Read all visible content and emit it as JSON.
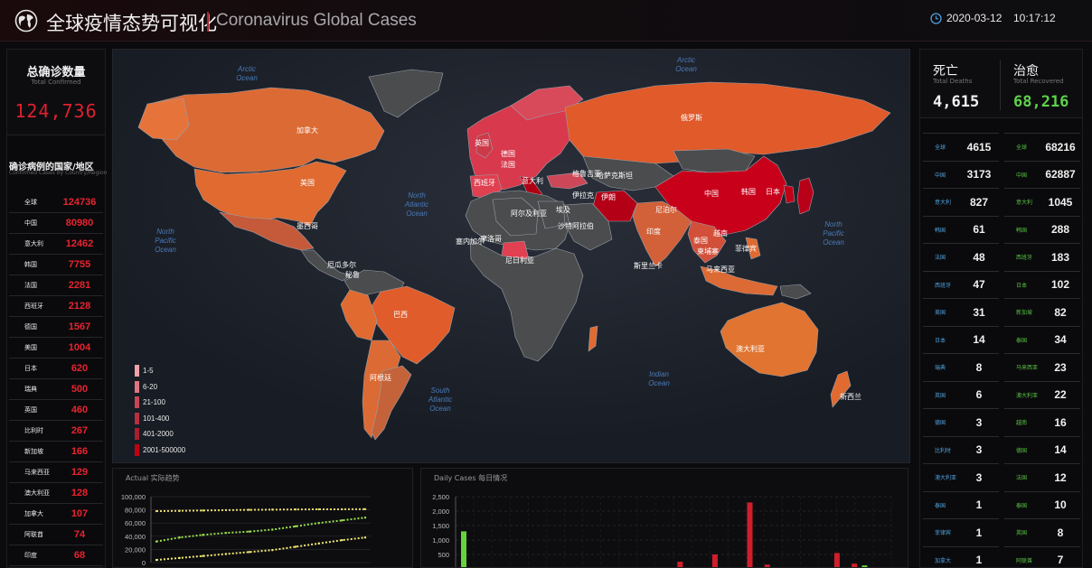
{
  "header": {
    "title_cn": "全球疫情态势可视化",
    "title_en": "Coronavirus Global Cases",
    "date": "2020-03-12",
    "time": "10:17:12",
    "icons": [
      "globe-icon",
      "clock-icon"
    ],
    "accent": "#b0232f"
  },
  "total_confirmed": {
    "label_cn": "总确诊数量",
    "label_en": "Total Confirmed",
    "value": "124,736"
  },
  "country_list": {
    "title_cn": "确诊病例的国家/地区",
    "title_en": "Confirmed Cases by Country/Region",
    "rows": [
      {
        "name": "全球",
        "value": "124736"
      },
      {
        "name": "中国",
        "value": "80980"
      },
      {
        "name": "意大利",
        "value": "12462"
      },
      {
        "name": "韩国",
        "value": "7755"
      },
      {
        "name": "法国",
        "value": "2281"
      },
      {
        "name": "西班牙",
        "value": "2128"
      },
      {
        "name": "德国",
        "value": "1567"
      },
      {
        "name": "美国",
        "value": "1004"
      },
      {
        "name": "日本",
        "value": "620"
      },
      {
        "name": "瑞典",
        "value": "500"
      },
      {
        "name": "英国",
        "value": "460"
      },
      {
        "name": "比利时",
        "value": "267"
      },
      {
        "name": "新加坡",
        "value": "166"
      },
      {
        "name": "马来西亚",
        "value": "129"
      },
      {
        "name": "澳大利亚",
        "value": "128"
      },
      {
        "name": "加拿大",
        "value": "107"
      },
      {
        "name": "阿联酋",
        "value": "74"
      },
      {
        "name": "印度",
        "value": "68"
      }
    ]
  },
  "map": {
    "oceans": [
      {
        "name": "Arctic Ocean",
        "l1": "Arctic",
        "l2": "Ocean"
      },
      {
        "name": "Arctic Ocean 2",
        "l1": "Arctic",
        "l2": "Ocean"
      },
      {
        "name": "North Atlantic Ocean",
        "l1": "North",
        "l2": "Atlantic",
        "l3": "Ocean"
      },
      {
        "name": "North Pacific Ocean W",
        "l1": "North",
        "l2": "Pacific",
        "l3": "Ocean"
      },
      {
        "name": "North Pacific Ocean E",
        "l1": "North",
        "l2": "Pacific",
        "l3": "Ocean"
      },
      {
        "name": "South Atlantic Ocean",
        "l1": "South",
        "l2": "Atlantic",
        "l3": "Ocean"
      },
      {
        "name": "Indian Ocean",
        "l1": "Indian",
        "l2": "Ocean"
      }
    ],
    "countries": [
      "加拿大",
      "美国",
      "墨西哥",
      "巴西",
      "秘鲁",
      "阿根廷",
      "厄瓜多尔",
      "俄罗斯",
      "中国",
      "韩国",
      "日本",
      "伊朗",
      "伊拉克",
      "印度",
      "澳大利亚",
      "新西兰",
      "尼日利亚",
      "阿尔及利亚",
      "埃及",
      "摩洛哥",
      "格鲁吉亚",
      "斯里兰卡",
      "英国",
      "德国",
      "法国",
      "西班牙",
      "意大利",
      "泰国",
      "菲律宾",
      "越南",
      "尼泊尔",
      "柬埔寨",
      "马来西亚",
      "塞内加尔",
      "沙特阿拉伯",
      "哈萨克斯坦"
    ],
    "legend": [
      {
        "label": "1-5",
        "color": "#f0a2a8"
      },
      {
        "label": "6-20",
        "color": "#e07480"
      },
      {
        "label": "21-100",
        "color": "#c84656"
      },
      {
        "label": "101-400",
        "color": "#b83040"
      },
      {
        "label": "401-2000",
        "color": "#a8202e"
      },
      {
        "label": "2001-500000",
        "color": "#c00014"
      }
    ]
  },
  "deaths": {
    "label_cn": "死亡",
    "label_en": "Total Deaths",
    "value": "4,615",
    "rows": [
      {
        "name": "全球",
        "value": "4615"
      },
      {
        "name": "中国",
        "value": "3173"
      },
      {
        "name": "意大利",
        "value": "827"
      },
      {
        "name": "韩国",
        "value": "61"
      },
      {
        "name": "法国",
        "value": "48"
      },
      {
        "name": "西班牙",
        "value": "47"
      },
      {
        "name": "美国",
        "value": "31"
      },
      {
        "name": "日本",
        "value": "14"
      },
      {
        "name": "瑞典",
        "value": "8"
      },
      {
        "name": "英国",
        "value": "6"
      },
      {
        "name": "德国",
        "value": "3"
      },
      {
        "name": "比利时",
        "value": "3"
      },
      {
        "name": "澳大利亚",
        "value": "3"
      },
      {
        "name": "泰国",
        "value": "1"
      },
      {
        "name": "菲律宾",
        "value": "1"
      },
      {
        "name": "加拿大",
        "value": "1"
      }
    ]
  },
  "recovered": {
    "label_cn": "治愈",
    "label_en": "Total Recovered",
    "value": "68,216",
    "rows": [
      {
        "name": "全球",
        "value": "68216"
      },
      {
        "name": "中国",
        "value": "62887"
      },
      {
        "name": "意大利",
        "value": "1045"
      },
      {
        "name": "韩国",
        "value": "288"
      },
      {
        "name": "西班牙",
        "value": "183"
      },
      {
        "name": "日本",
        "value": "102"
      },
      {
        "name": "新加坡",
        "value": "82"
      },
      {
        "name": "泰国",
        "value": "34"
      },
      {
        "name": "马来西亚",
        "value": "23"
      },
      {
        "name": "澳大利亚",
        "value": "22"
      },
      {
        "name": "越南",
        "value": "16"
      },
      {
        "name": "德国",
        "value": "14"
      },
      {
        "name": "法国",
        "value": "12"
      },
      {
        "name": "泰国",
        "value": "10"
      },
      {
        "name": "英国",
        "value": "8"
      },
      {
        "name": "阿联酋",
        "value": "7"
      }
    ]
  },
  "chart_data": [
    {
      "type": "line",
      "title": "Actual 实际趋势",
      "yticks": [
        "100,000",
        "80,000",
        "60,000",
        "40,000",
        "20,000",
        "0"
      ],
      "ylim": [
        0,
        100000
      ],
      "series": [
        {
          "color": "#e8d86a",
          "values": [
            78000,
            78500,
            79000,
            79500,
            80000,
            80300,
            80600,
            80800,
            80900,
            80980
          ]
        },
        {
          "color": "#9adf4a",
          "values": [
            32000,
            38000,
            42000,
            45000,
            47000,
            50000,
            55000,
            60000,
            64000,
            68216
          ]
        },
        {
          "color": "#f0e870",
          "values": [
            4000,
            7000,
            10000,
            13000,
            16000,
            19000,
            24000,
            29000,
            34000,
            38000
          ]
        }
      ]
    },
    {
      "type": "bar",
      "title": "Daily Cases 每日情况",
      "yticks": [
        "2,500",
        "2,000",
        "1,500",
        "1,000",
        "500",
        "0"
      ],
      "ylim": [
        0,
        2500
      ],
      "series": [
        {
          "color": "#65d33a",
          "values": [
            1300,
            0,
            30,
            0,
            40,
            0,
            0,
            0,
            0,
            0,
            0,
            0,
            0,
            0,
            0,
            0,
            0,
            0,
            0,
            0,
            0,
            20,
            0,
            120,
            0
          ]
        },
        {
          "color": "#d01e2b",
          "values": [
            0,
            0,
            0,
            0,
            0,
            0,
            0,
            0,
            0,
            0,
            0,
            0,
            250,
            0,
            500,
            0,
            2300,
            150,
            0,
            0,
            0,
            550,
            180,
            0,
            0
          ]
        }
      ]
    }
  ]
}
